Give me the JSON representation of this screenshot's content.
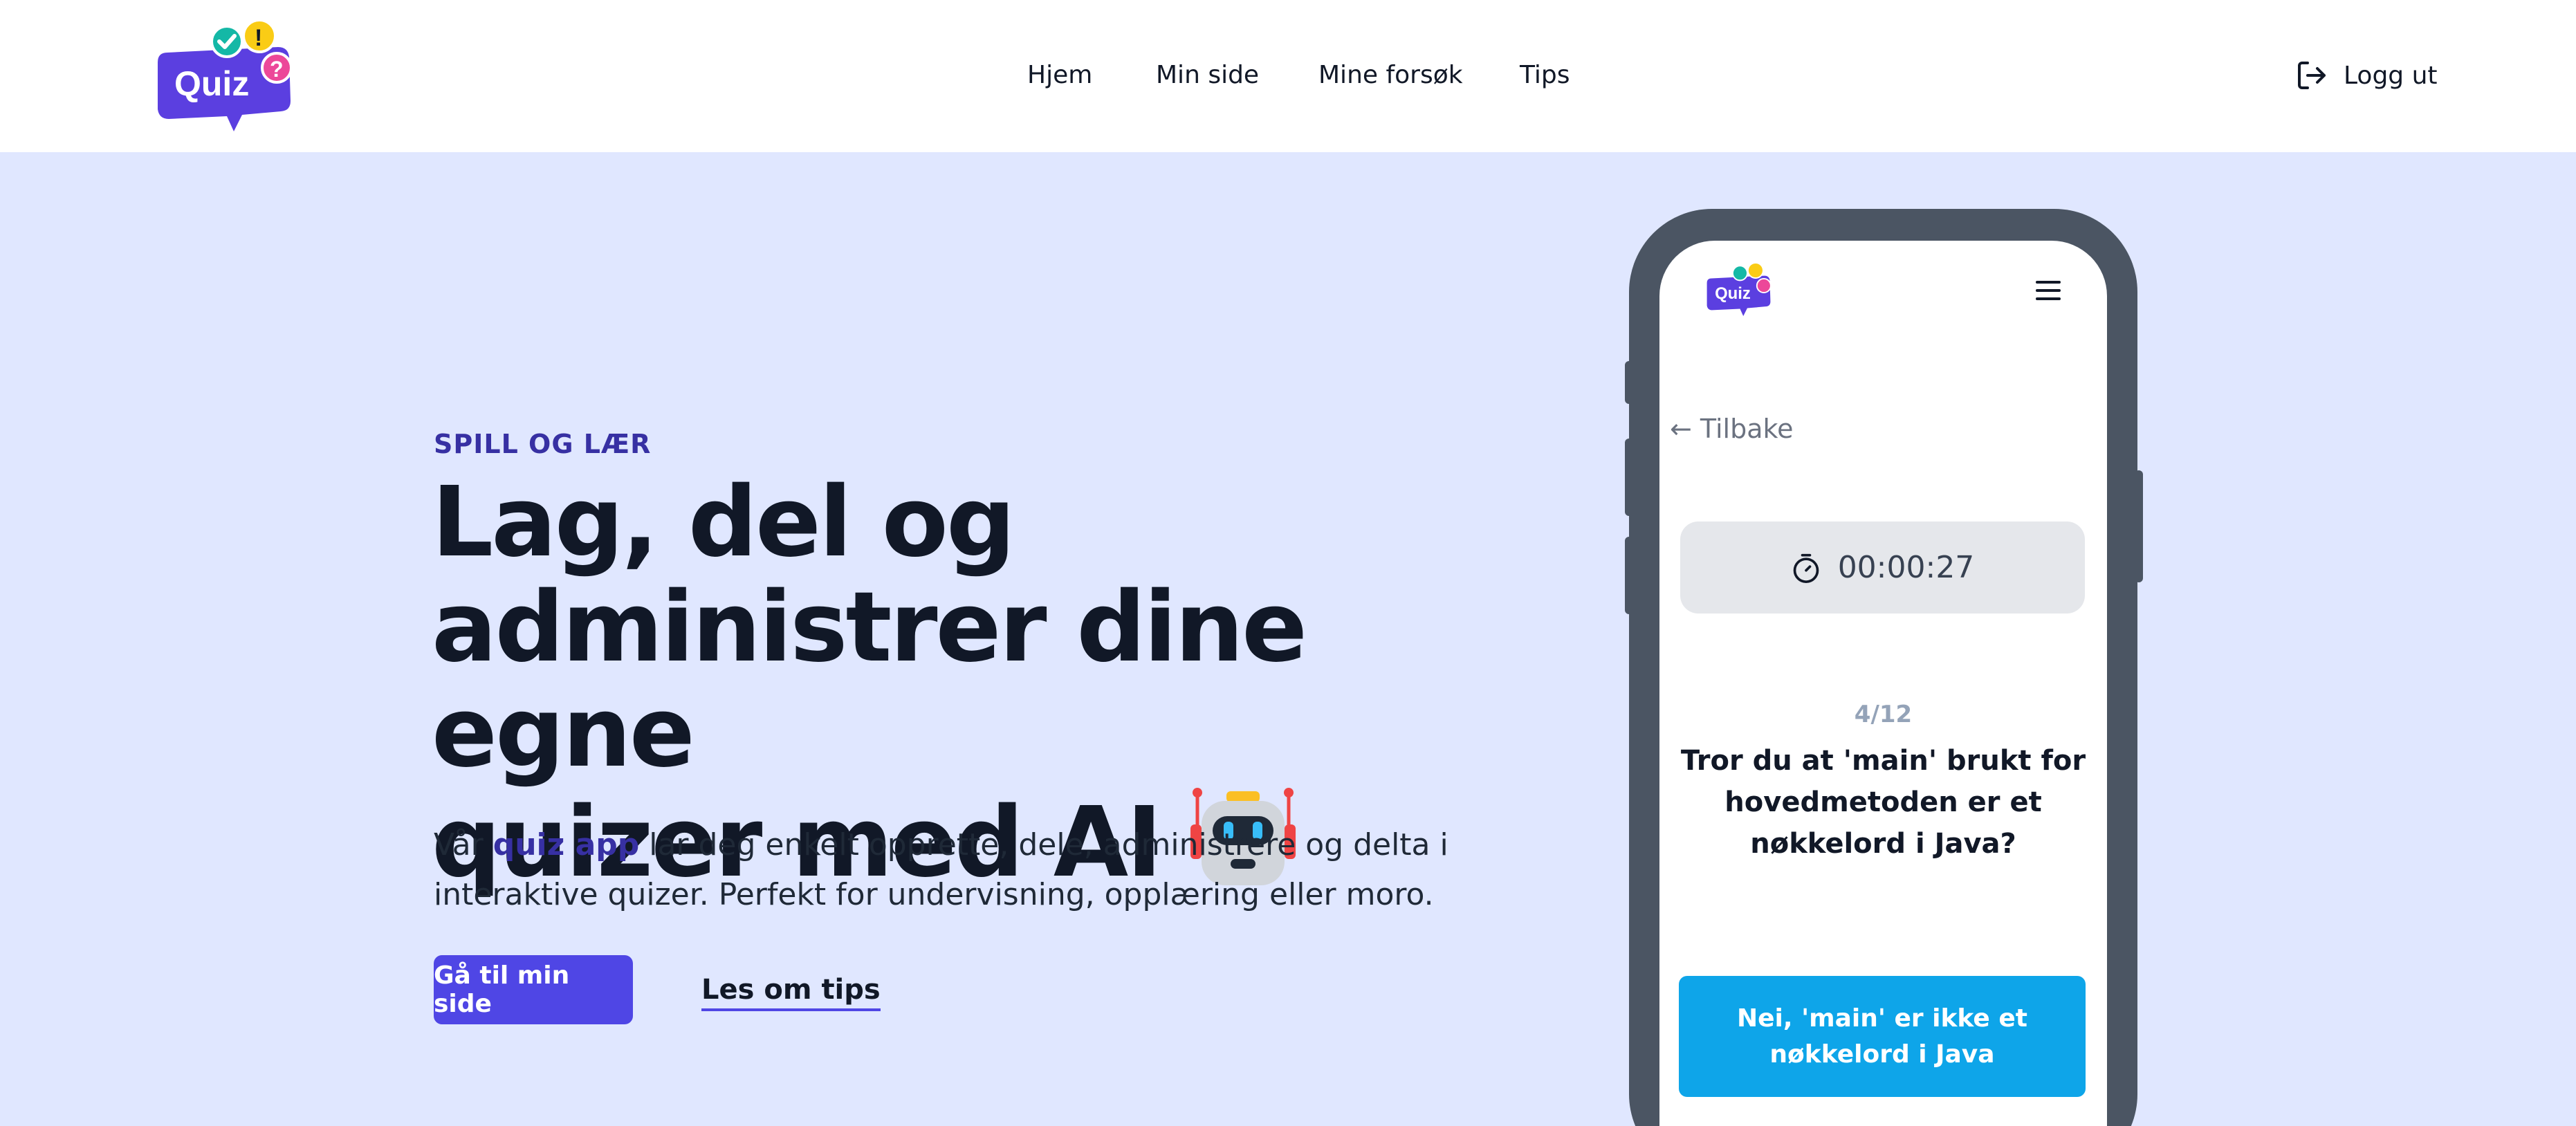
{
  "header": {
    "logo_text": "Quiz",
    "nav": [
      {
        "label": "Hjem"
      },
      {
        "label": "Min side"
      },
      {
        "label": "Mine forsøk"
      },
      {
        "label": "Tips"
      }
    ],
    "logout_label": "Logg ut"
  },
  "hero": {
    "eyebrow": "SPILL OG LÆR",
    "headline_line1": "Lag, del og",
    "headline_line2": "administrer dine egne",
    "headline_line3": "quizer med AI",
    "description_start": "Vår ",
    "description_highlight": "quiz app",
    "description_end": " lar deg enkelt opprette, dele, administrere og delta i interaktive quizer. Perfekt for undervisning, opplæring eller moro.",
    "primary_button": "Gå til min side",
    "secondary_link": "Les om tips"
  },
  "phone": {
    "back_label": "← Tilbake",
    "timer": "00:00:27",
    "progress": "4/12",
    "question": "Tror du at 'main' brukt for hovedmetoden er et nøkkelord i Java?",
    "answer": "Nei, 'main' er ikke et nøkkelord i Java"
  },
  "colors": {
    "hero_bg": "#e0e7ff",
    "accent": "#4f46e5",
    "eyebrow": "#3730a3",
    "answer_bg": "#0ea5e9",
    "phone_frame": "#4b5563"
  },
  "icons": {
    "logo": "quiz-speech-bubble-logo",
    "logout": "logout-icon",
    "robot": "robot-emoji",
    "menu": "hamburger-icon",
    "timer": "stopwatch-icon"
  }
}
